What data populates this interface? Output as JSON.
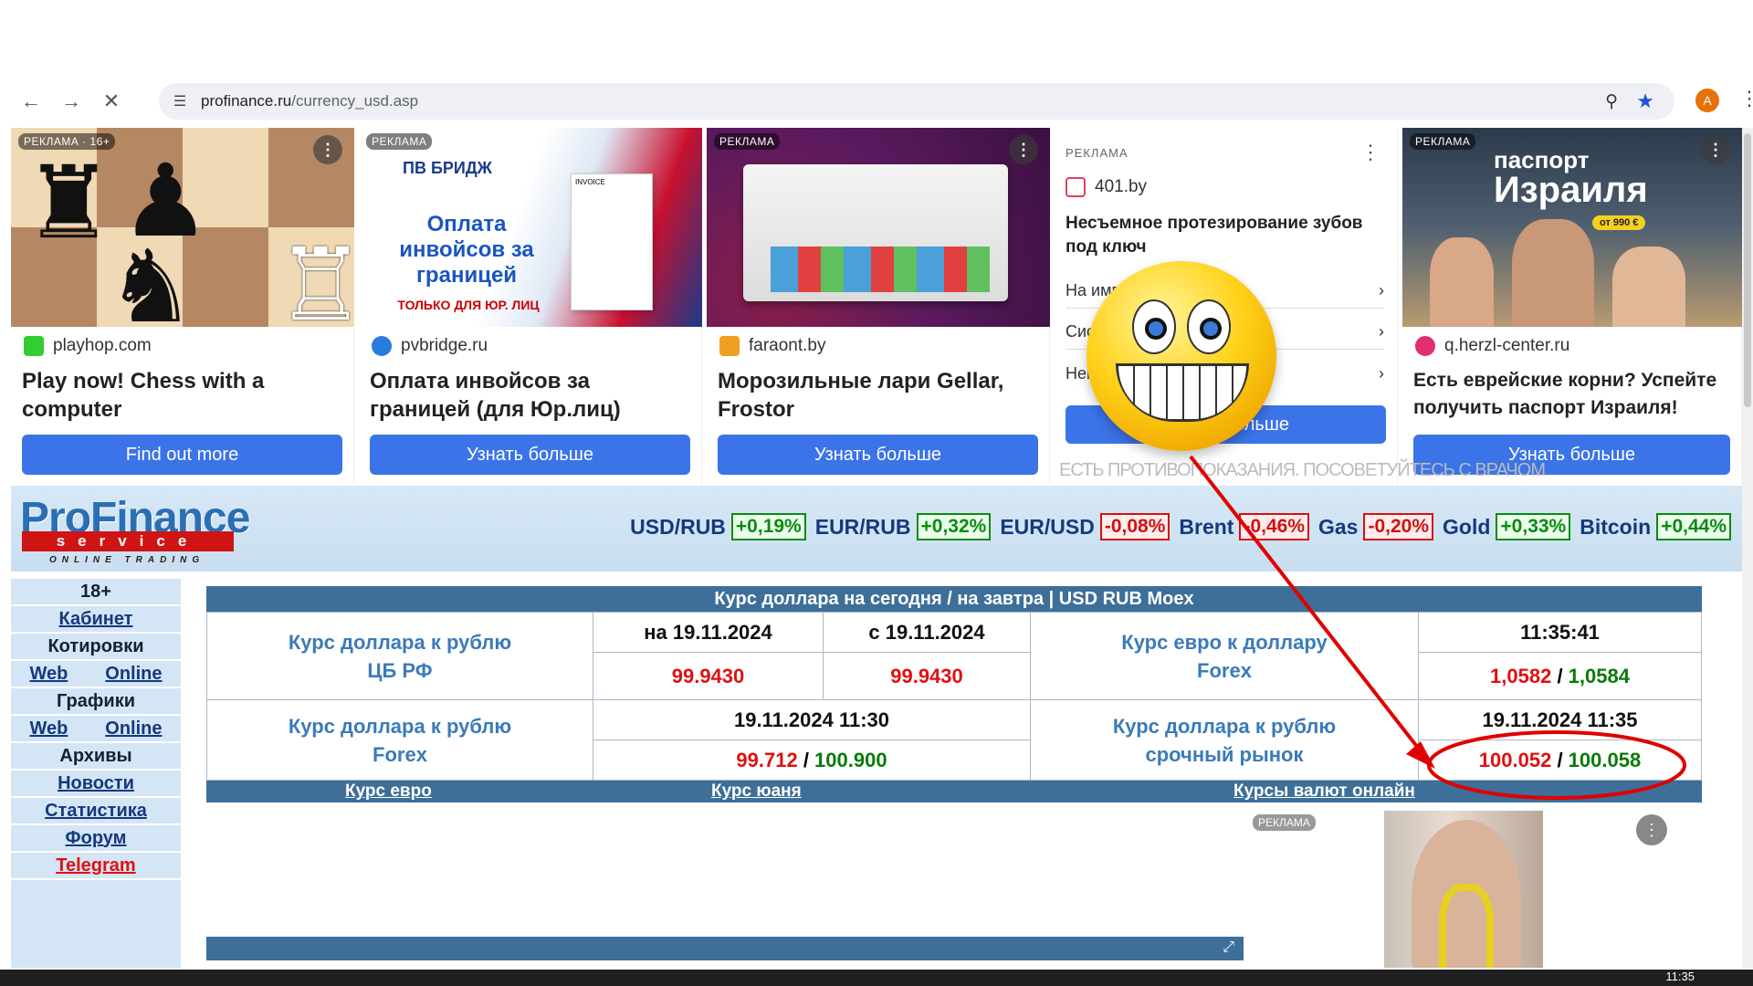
{
  "browser": {
    "url_host": "profinance.ru",
    "url_path": "/currency_usd.asp",
    "avatar_letter": "A"
  },
  "ads": [
    {
      "tag": "РЕКЛАМА · 16+",
      "domain": "playhop.com",
      "title": "Play now! Chess with a computer",
      "button": "Find out more"
    },
    {
      "tag": "РЕКЛАМА",
      "domain": "pvbridge.ru",
      "title": "Оплата инвойсов за границей (для Юр.лиц)",
      "button": "Узнать больше",
      "img_brand": "ПВ БРИДЖ",
      "img_head": "Оплата инвойсов за границей",
      "img_sub": "ТОЛЬКО ДЛЯ ЮР. ЛИЦ",
      "img_doc": "INVOICE"
    },
    {
      "tag": "РЕКЛАМА",
      "domain": "faraont.by",
      "title": "Морозильные лари Gellar, Frostor",
      "button": "Узнать больше"
    },
    {
      "tag": "РЕКЛАМА",
      "domain": "401.by",
      "title": "Несъемное протезирование зубов под ключ",
      "rows": [
        "На имп",
        "Сис",
        "Нем"
      ],
      "button": "Узнать больше",
      "disclaimer": "ЕСТЬ ПРОТИВОПОКАЗАНИЯ. ПОСОВЕТУЙТЕСЬ С ВРАЧОМ"
    },
    {
      "tag": "РЕКЛАМА",
      "domain": "q.herzl-center.ru",
      "title": "Есть еврейские корни? Успейте получить паспорт Израиля!",
      "button": "Узнать больше",
      "img_head1": "паспорт",
      "img_head2": "Израиля",
      "img_price": "от 990 €"
    }
  ],
  "logo": {
    "line1": "ProFinance",
    "line2": "service",
    "line3": "ONLINE TRADING"
  },
  "tickers": [
    {
      "name": "USD/RUB",
      "change": "+0,19%",
      "dir": "up"
    },
    {
      "name": "EUR/RUB",
      "change": "+0,32%",
      "dir": "up"
    },
    {
      "name": "EUR/USD",
      "change": "-0,08%",
      "dir": "down"
    },
    {
      "name": "Brent",
      "change": "-0,46%",
      "dir": "down"
    },
    {
      "name": "Gas",
      "change": "-0,20%",
      "dir": "down"
    },
    {
      "name": "Gold",
      "change": "+0,33%",
      "dir": "up"
    },
    {
      "name": "Bitcoin",
      "change": "+0,44%",
      "dir": "up"
    }
  ],
  "sidebar": {
    "age": "18+",
    "cabinet": "Кабинет",
    "quotes": "Котировки",
    "web": "Web",
    "online": "Online",
    "charts": "Графики",
    "web2": "Web",
    "online2": "Online",
    "archives": "Архивы",
    "news": "Новости",
    "stats": "Статистика",
    "forum": "Форум",
    "telegram": "Telegram"
  },
  "table": {
    "title": "Курс доллара на сегодня / на завтра | USD RUB Moex",
    "cb_label": "Курс доллара к рублю ЦБ РФ",
    "cb_date1": "на 19.11.2024",
    "cb_date2": "с 19.11.2024",
    "cb_val1": "99.9430",
    "cb_val2": "99.9430",
    "eur_label": "Курс евро к доллару Forex",
    "eur_time": "11:35:41",
    "eur_bid": "1,0582",
    "eur_ask": "1,0584",
    "fx_label": "Курс доллара к рублю Forex",
    "fx_time": "19.11.2024 11:30",
    "fx_bid": "99.712",
    "fx_ask": "100.900",
    "fut_label": "Курс доллара к рублю срочный рынок",
    "fut_time": "19.11.2024 11:35",
    "fut_bid": "100.052",
    "fut_ask": "100.058",
    "sep": " / "
  },
  "links": {
    "euro": "Курс евро",
    "yuan": "Курс юаня",
    "online": "Курсы валют онлайн"
  },
  "ad_right": {
    "tag": "РЕКЛАМА"
  },
  "taskbar": {
    "time": "11:35"
  },
  "colors": {
    "accent_blue": "#3b74e8",
    "table_bar": "#3d6f99",
    "up": "#0c8a12",
    "down": "#d31010",
    "annotation": "#e00000"
  },
  "icons": [
    "back-arrow-icon",
    "forward-arrow-icon",
    "stop-icon",
    "site-settings-icon",
    "zoom-icon",
    "bookmark-star-icon",
    "more-vert-icon",
    "smiley-emoji-icon"
  ]
}
